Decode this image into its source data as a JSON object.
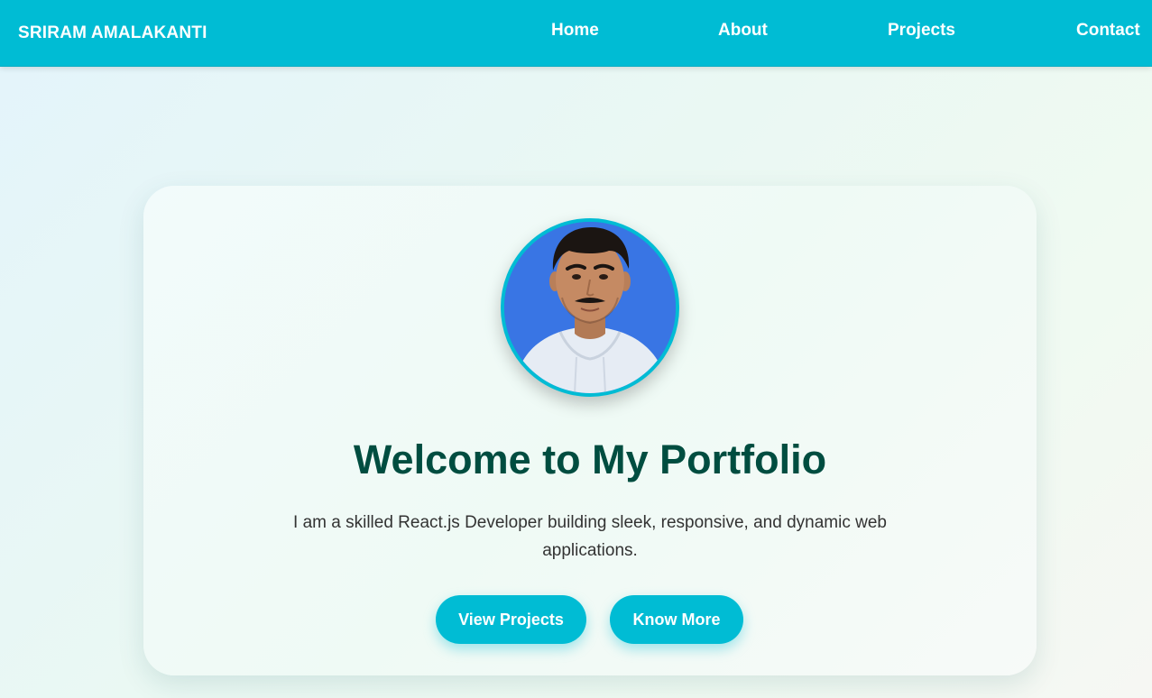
{
  "navbar": {
    "brand": "SRIRAM AMALAKANTI",
    "links": [
      {
        "label": "Home"
      },
      {
        "label": "About"
      },
      {
        "label": "Projects"
      },
      {
        "label": "Contact"
      }
    ]
  },
  "hero": {
    "avatar_icon": "profile-photo",
    "title": "Welcome to My Portfolio",
    "description": "I am a skilled React.js Developer building sleek, responsive, and dynamic web applications.",
    "buttons": [
      {
        "label": "View Projects"
      },
      {
        "label": "Know More"
      }
    ]
  },
  "colors": {
    "accent": "#00bcd4",
    "title": "#004d40",
    "text": "#333333"
  }
}
